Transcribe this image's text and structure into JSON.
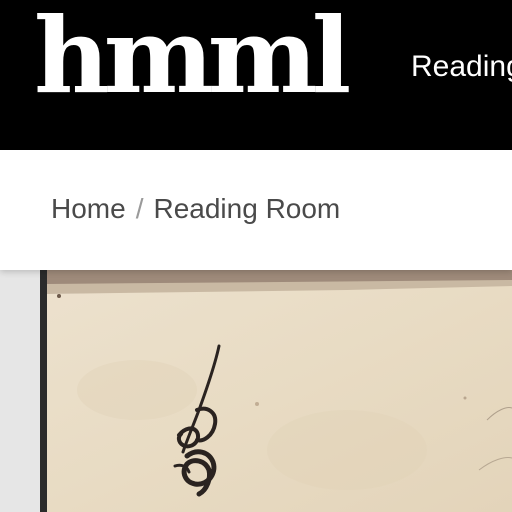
{
  "header": {
    "logo_text": "hmml",
    "nav": {
      "reading_room_label": "Reading"
    }
  },
  "breadcrumb": {
    "items": [
      {
        "label": "Home"
      },
      {
        "label": "Reading Room"
      }
    ],
    "separator": "/"
  },
  "viewer": {
    "image": "manuscript-page"
  },
  "colors": {
    "header_bg": "#000000",
    "header_text": "#ffffff",
    "breadcrumb_text": "#4a4a4a",
    "separator": "#9a9a9a",
    "parchment": "#e9dcc6"
  }
}
